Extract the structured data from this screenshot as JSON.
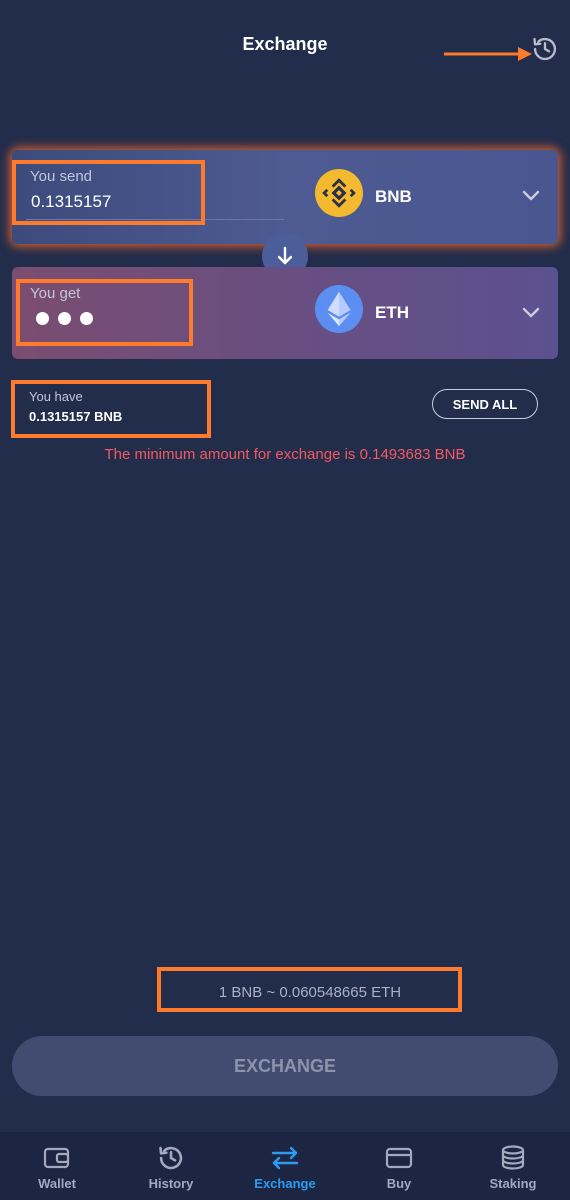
{
  "header": {
    "title": "Exchange",
    "history_icon": "history-icon"
  },
  "send_card": {
    "label": "You send",
    "value": "0.1315157",
    "coin": "BNB",
    "coin_icon": "bnb-coin-icon",
    "coin_color": "#f3ba2f"
  },
  "get_card": {
    "label": "You get",
    "value_state": "loading",
    "coin": "ETH",
    "coin_icon": "eth-coin-icon",
    "coin_color": "#5c8ef2"
  },
  "balance": {
    "label": "You have",
    "value": "0.1315157 BNB",
    "send_all_label": "SEND ALL"
  },
  "warning": "The minimum amount for exchange is 0.1493683 BNB",
  "rate": "1 BNB ~ 0.060548665 ETH",
  "exchange_button": "EXCHANGE",
  "nav": {
    "items": [
      {
        "label": "Wallet",
        "icon": "wallet-icon"
      },
      {
        "label": "History",
        "icon": "history-icon"
      },
      {
        "label": "Exchange",
        "icon": "exchange-arrows-icon",
        "active": true
      },
      {
        "label": "Buy",
        "icon": "card-icon"
      },
      {
        "label": "Staking",
        "icon": "coins-stack-icon"
      }
    ]
  },
  "colors": {
    "background": "#222c4b",
    "accent": "#2c9bf2",
    "warning": "#f25a5e",
    "annotation": "#ff7a2a"
  }
}
